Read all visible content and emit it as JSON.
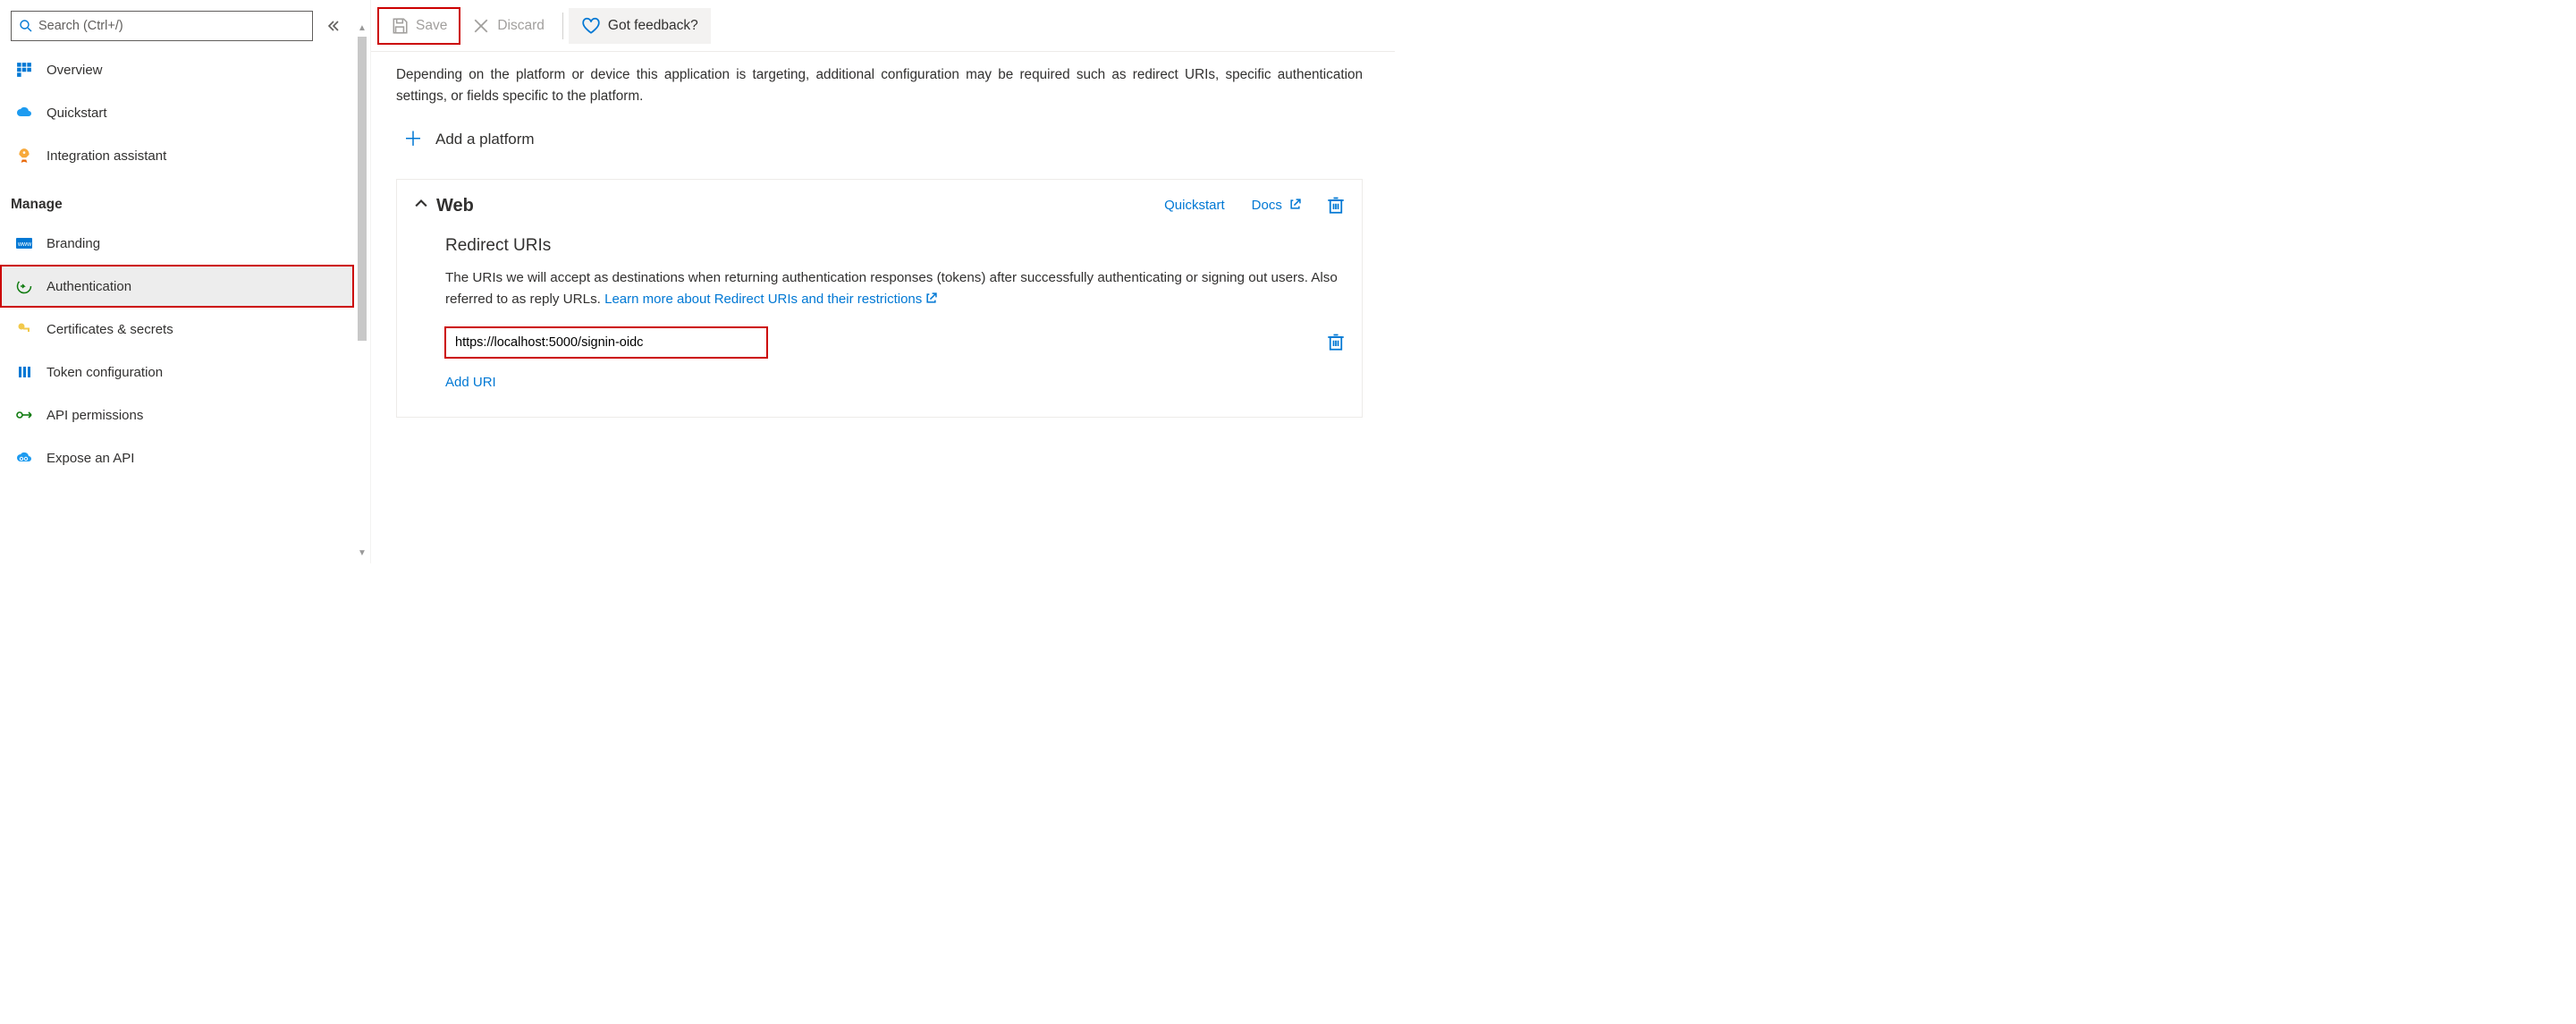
{
  "search": {
    "placeholder": "Search (Ctrl+/)"
  },
  "nav": {
    "top": [
      {
        "label": "Overview"
      },
      {
        "label": "Quickstart"
      },
      {
        "label": "Integration assistant"
      }
    ],
    "section_label": "Manage",
    "manage": [
      {
        "label": "Branding"
      },
      {
        "label": "Authentication"
      },
      {
        "label": "Certificates & secrets"
      },
      {
        "label": "Token configuration"
      },
      {
        "label": "API permissions"
      },
      {
        "label": "Expose an API"
      }
    ]
  },
  "toolbar": {
    "save_label": "Save",
    "discard_label": "Discard",
    "feedback_label": "Got feedback?"
  },
  "content": {
    "intro": "Depending on the platform or device this application is targeting, additional configuration may be required such as redirect URIs, specific authentication settings, or fields specific to the platform.",
    "add_platform_label": "Add a platform"
  },
  "card": {
    "title": "Web",
    "quickstart_label": "Quickstart",
    "docs_label": "Docs",
    "redirect_heading": "Redirect URIs",
    "redirect_desc_1": "The URIs we will accept as destinations when returning authentication responses (tokens) after successfully authenticating or signing out users. Also referred to as reply URLs. ",
    "redirect_link": "Learn more about Redirect URIs and their restrictions",
    "uri_value": "https://localhost:5000/signin-oidc",
    "add_uri_label": "Add URI"
  }
}
